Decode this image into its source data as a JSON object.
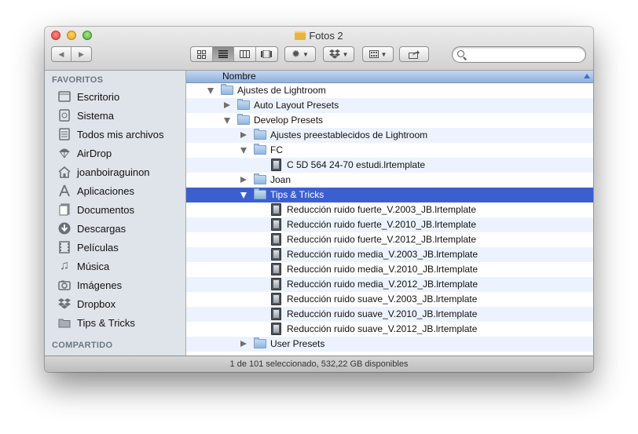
{
  "window": {
    "title": "Fotos 2",
    "title_icon": "folder-icon"
  },
  "toolbar": {
    "back": "◀",
    "forward": "▶",
    "view_icon": "icon-view-icon",
    "view_list": "list-view-icon",
    "view_columns": "column-view-icon",
    "view_coverflow": "coverflow-view-icon",
    "action_icon": "gear-icon",
    "dropbox_icon": "dropbox-icon",
    "arrange_icon": "arrange-icon",
    "share_icon": "share-icon",
    "search_placeholder": ""
  },
  "sidebar": {
    "favorites_header": "FAVORITOS",
    "shared_header": "COMPARTIDO",
    "items": [
      {
        "label": "Escritorio",
        "icon": "desktop-icon"
      },
      {
        "label": "Sistema",
        "icon": "drive-icon"
      },
      {
        "label": "Todos mis archivos",
        "icon": "all-files-icon"
      },
      {
        "label": "AirDrop",
        "icon": "airdrop-icon"
      },
      {
        "label": "joanboiraguinon",
        "icon": "home-icon"
      },
      {
        "label": "Aplicaciones",
        "icon": "applications-icon"
      },
      {
        "label": "Documentos",
        "icon": "documents-icon"
      },
      {
        "label": "Descargas",
        "icon": "downloads-icon"
      },
      {
        "label": "Películas",
        "icon": "movies-icon"
      },
      {
        "label": "Música",
        "icon": "music-icon"
      },
      {
        "label": "Imágenes",
        "icon": "pictures-icon"
      },
      {
        "label": "Dropbox",
        "icon": "dropbox-icon"
      },
      {
        "label": "Tips & Tricks",
        "icon": "folder-icon"
      }
    ]
  },
  "list": {
    "column_header": "Nombre",
    "rows": [
      {
        "name": "Ajustes de Lightroom",
        "kind": "folder",
        "level": 0,
        "disclosure": "open"
      },
      {
        "name": "Auto Layout Presets",
        "kind": "folder",
        "level": 1,
        "disclosure": "closed"
      },
      {
        "name": "Develop Presets",
        "kind": "folder",
        "level": 1,
        "disclosure": "open"
      },
      {
        "name": "Ajustes preestablecidos de Lightroom",
        "kind": "folder",
        "level": 2,
        "disclosure": "closed"
      },
      {
        "name": "FC",
        "kind": "folder",
        "level": 2,
        "disclosure": "open"
      },
      {
        "name": "C 5D 564 24-70 estudi.lrtemplate",
        "kind": "file",
        "level": 3,
        "disclosure": "none"
      },
      {
        "name": "Joan",
        "kind": "folder",
        "level": 2,
        "disclosure": "closed"
      },
      {
        "name": "Tips & Tricks",
        "kind": "folder",
        "level": 2,
        "disclosure": "open",
        "selected": true
      },
      {
        "name": "Reducción ruido fuerte_V.2003_JB.lrtemplate",
        "kind": "file",
        "level": 3,
        "disclosure": "none"
      },
      {
        "name": "Reducción ruido fuerte_V.2010_JB.lrtemplate",
        "kind": "file",
        "level": 3,
        "disclosure": "none"
      },
      {
        "name": "Reducción ruido fuerte_V.2012_JB.lrtemplate",
        "kind": "file",
        "level": 3,
        "disclosure": "none"
      },
      {
        "name": "Reducción ruido media_V.2003_JB.lrtemplate",
        "kind": "file",
        "level": 3,
        "disclosure": "none"
      },
      {
        "name": "Reducción ruido media_V.2010_JB.lrtemplate",
        "kind": "file",
        "level": 3,
        "disclosure": "none"
      },
      {
        "name": "Reducción ruido media_V.2012_JB.lrtemplate",
        "kind": "file",
        "level": 3,
        "disclosure": "none"
      },
      {
        "name": "Reducción ruido suave_V.2003_JB.lrtemplate",
        "kind": "file",
        "level": 3,
        "disclosure": "none"
      },
      {
        "name": "Reducción ruido suave_V.2010_JB.lrtemplate",
        "kind": "file",
        "level": 3,
        "disclosure": "none"
      },
      {
        "name": "Reducción ruido suave_V.2012_JB.lrtemplate",
        "kind": "file",
        "level": 3,
        "disclosure": "none"
      },
      {
        "name": "User Presets",
        "kind": "folder",
        "level": 2,
        "disclosure": "closed"
      }
    ]
  },
  "status": {
    "text": "1 de 101 seleccionado, 532,22 GB disponibles"
  },
  "colors": {
    "selection": "#3c5fd0",
    "alt_row": "#edf3fe",
    "sidebar_bg": "#dfe4ea"
  }
}
